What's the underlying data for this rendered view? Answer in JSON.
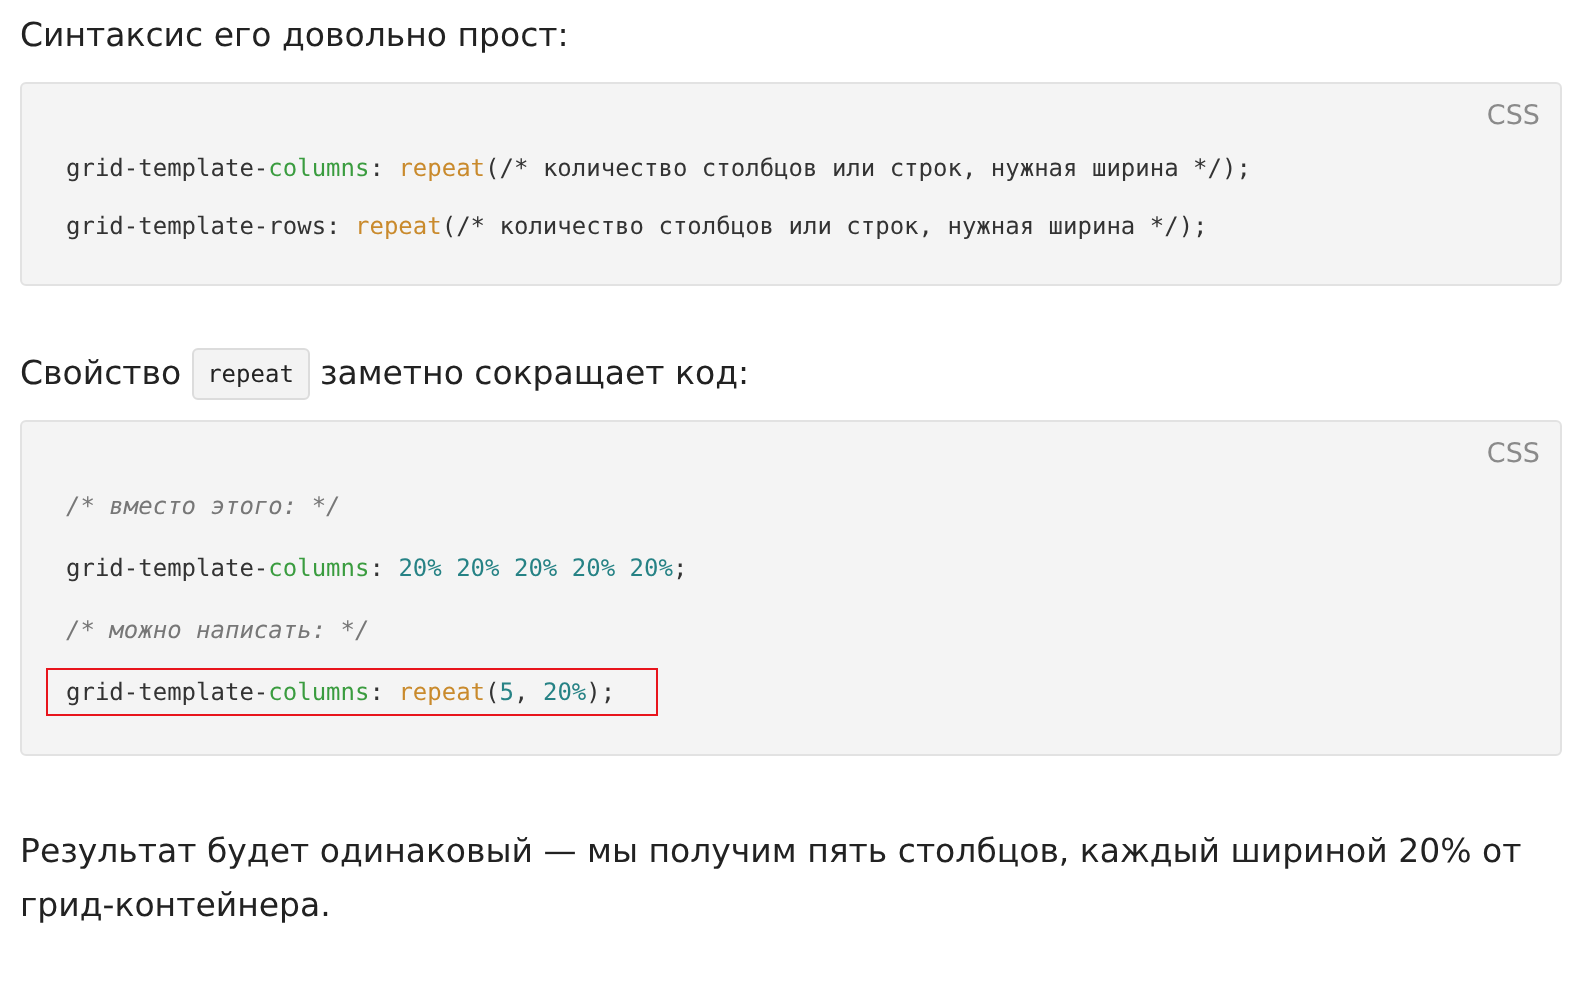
{
  "blocks": [
    {
      "kind": "paragraph",
      "parts": [
        {
          "kind": "text",
          "text": "Синтаксис его довольно прост:"
        }
      ]
    },
    {
      "kind": "code",
      "language": "CSS",
      "lines": [
        {
          "highlighted": false,
          "tokens": [
            {
              "kind": "plain",
              "text": "grid-template-"
            },
            {
              "kind": "prop",
              "text": "columns"
            },
            {
              "kind": "plain",
              "text": ": "
            },
            {
              "kind": "func",
              "text": "repeat"
            },
            {
              "kind": "plain",
              "text": "(/* количество столбцов или строк, нужная ширина */);"
            }
          ]
        },
        {
          "highlighted": false,
          "tokens": [
            {
              "kind": "plain",
              "text": "grid-template-rows: "
            },
            {
              "kind": "func",
              "text": "repeat"
            },
            {
              "kind": "plain",
              "text": "(/* количество столбцов или строк, нужная ширина */);"
            }
          ]
        }
      ]
    },
    {
      "kind": "paragraph",
      "parts": [
        {
          "kind": "text",
          "text": "Свойство"
        },
        {
          "kind": "code",
          "text": "repeat"
        },
        {
          "kind": "text",
          "text": "заметно сокращает код:"
        }
      ]
    },
    {
      "kind": "code",
      "language": "CSS",
      "lines": [
        {
          "highlighted": false,
          "tokens": [
            {
              "kind": "comment",
              "text": "/* вместо этого: */"
            }
          ]
        },
        {
          "highlighted": false,
          "tokens": [
            {
              "kind": "plain",
              "text": "grid-template-"
            },
            {
              "kind": "prop",
              "text": "columns"
            },
            {
              "kind": "plain",
              "text": ": "
            },
            {
              "kind": "number",
              "text": "20% 20% 20% 20% 20%"
            },
            {
              "kind": "plain",
              "text": ";"
            }
          ]
        },
        {
          "highlighted": false,
          "tokens": [
            {
              "kind": "comment",
              "text": "/* можно написать: */"
            }
          ]
        },
        {
          "highlighted": true,
          "tokens": [
            {
              "kind": "plain",
              "text": "grid-template-"
            },
            {
              "kind": "prop",
              "text": "columns"
            },
            {
              "kind": "plain",
              "text": ": "
            },
            {
              "kind": "func",
              "text": "repeat"
            },
            {
              "kind": "plain",
              "text": "("
            },
            {
              "kind": "number",
              "text": "5"
            },
            {
              "kind": "plain",
              "text": ", "
            },
            {
              "kind": "number",
              "text": "20%"
            },
            {
              "kind": "plain",
              "text": ");"
            }
          ]
        }
      ]
    },
    {
      "kind": "paragraph",
      "parts": [
        {
          "kind": "text",
          "text": "Результат будет одинаковый — мы получим пять столбцов, каждый шириной 20% от грид-контейнера."
        }
      ]
    }
  ]
}
